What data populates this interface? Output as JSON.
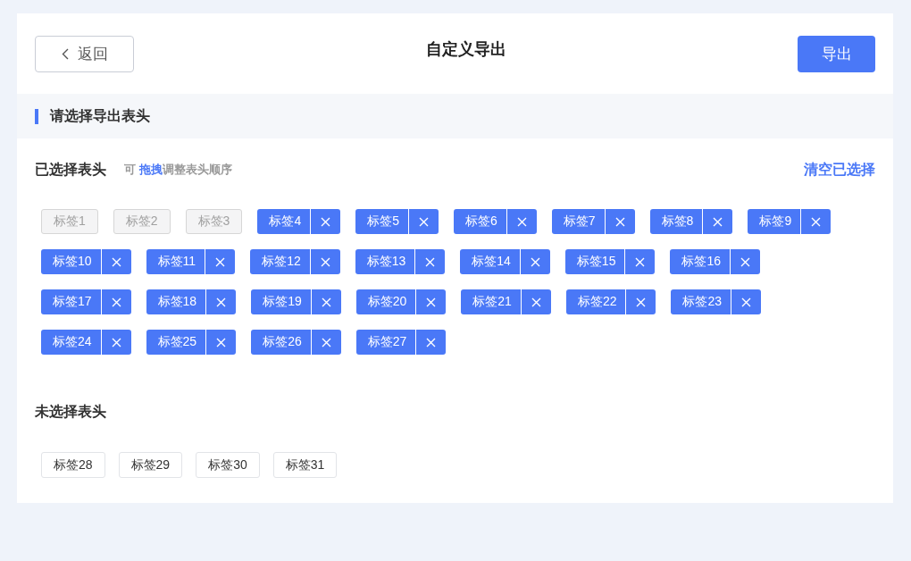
{
  "header": {
    "back_button": "返回",
    "title": "自定义导出",
    "export_button": "导出"
  },
  "section_title": "请选择导出表头",
  "selected": {
    "heading": "已选择表头",
    "hint": "可 **拖拽**调整表头顺序",
    "clear_link": "清空已选择",
    "tags": [
      {
        "label": "标签1",
        "kind": "fixed"
      },
      {
        "label": "标签2",
        "kind": "fixed"
      },
      {
        "label": "标签3",
        "kind": "fixed"
      },
      {
        "label": "标签4",
        "kind": "removable"
      },
      {
        "label": "标签5",
        "kind": "removable"
      },
      {
        "label": "标签6",
        "kind": "removable"
      },
      {
        "label": "标签7",
        "kind": "removable"
      },
      {
        "label": "标签8",
        "kind": "removable"
      },
      {
        "label": "标签9",
        "kind": "removable"
      },
      {
        "label": "标签10",
        "kind": "removable"
      },
      {
        "label": "标签11",
        "kind": "removable"
      },
      {
        "label": "标签12",
        "kind": "removable"
      },
      {
        "label": "标签13",
        "kind": "removable"
      },
      {
        "label": "标签14",
        "kind": "removable"
      },
      {
        "label": "标签15",
        "kind": "removable"
      },
      {
        "label": "标签16",
        "kind": "removable"
      },
      {
        "label": "标签17",
        "kind": "removable"
      },
      {
        "label": "标签18",
        "kind": "removable"
      },
      {
        "label": "标签19",
        "kind": "removable"
      },
      {
        "label": "标签20",
        "kind": "removable"
      },
      {
        "label": "标签21",
        "kind": "removable"
      },
      {
        "label": "标签22",
        "kind": "removable"
      },
      {
        "label": "标签23",
        "kind": "removable"
      },
      {
        "label": "标签24",
        "kind": "removable"
      },
      {
        "label": "标签25",
        "kind": "removable"
      },
      {
        "label": "标签26",
        "kind": "removable"
      },
      {
        "label": "标签27",
        "kind": "removable"
      }
    ]
  },
  "unselected": {
    "heading": "未选择表头",
    "tags": [
      {
        "label": "标签28"
      },
      {
        "label": "标签29"
      },
      {
        "label": "标签30"
      },
      {
        "label": "标签31"
      }
    ]
  }
}
